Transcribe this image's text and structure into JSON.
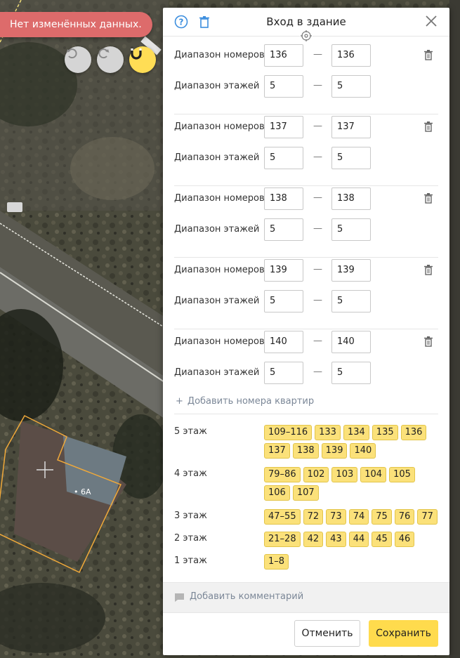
{
  "map": {
    "status_text": "Нет изменённых данных.",
    "house_label": "• 6А"
  },
  "panel": {
    "title": "Вход в здание",
    "entries": [
      {
        "numbers_label": "Диапазон номеров",
        "num_from": "136",
        "num_to": "136",
        "floors_label": "Диапазон этажей",
        "floor_from": "5",
        "floor_to": "5"
      },
      {
        "numbers_label": "Диапазон номеров",
        "num_from": "137",
        "num_to": "137",
        "floors_label": "Диапазон этажей",
        "floor_from": "5",
        "floor_to": "5"
      },
      {
        "numbers_label": "Диапазон номеров",
        "num_from": "138",
        "num_to": "138",
        "floors_label": "Диапазон этажей",
        "floor_from": "5",
        "floor_to": "5"
      },
      {
        "numbers_label": "Диапазон номеров",
        "num_from": "139",
        "num_to": "139",
        "floors_label": "Диапазон этажей",
        "floor_from": "5",
        "floor_to": "5"
      },
      {
        "numbers_label": "Диапазон номеров",
        "num_from": "140",
        "num_to": "140",
        "floors_label": "Диапазон этажей",
        "floor_from": "5",
        "floor_to": "5"
      }
    ],
    "dash": "—",
    "add_link": "Добавить номера квартир",
    "add_plus": "+",
    "floors": [
      {
        "label": "5 этаж",
        "chips": [
          "109–116",
          "133",
          "134",
          "135",
          "136",
          "137",
          "138",
          "139",
          "140"
        ]
      },
      {
        "label": "4 этаж",
        "chips": [
          "79–86",
          "102",
          "103",
          "104",
          "105",
          "106",
          "107"
        ]
      },
      {
        "label": "3 этаж",
        "chips": [
          "47–55",
          "72",
          "73",
          "74",
          "75",
          "76",
          "77"
        ]
      },
      {
        "label": "2 этаж",
        "chips": [
          "21–28",
          "42",
          "43",
          "44",
          "45",
          "46"
        ]
      },
      {
        "label": "1 этаж",
        "chips": [
          "1–8"
        ]
      }
    ],
    "comment_link": "Добавить комментарий",
    "cancel_label": "Отменить",
    "save_label": "Сохранить"
  },
  "icons": {
    "help": "help-circle-icon",
    "trash": "trash-icon",
    "close": "close-icon",
    "target": "crosshair-icon",
    "undo": "undo-icon",
    "redo": "redo-icon",
    "magnet": "magnet-icon",
    "comment": "comment-icon"
  },
  "colors": {
    "status_pill": "#dd6b6b",
    "accent_yellow": "#ffdb4d",
    "chip_fill": "#fbe17a",
    "link_grey": "#7b8797",
    "help_blue": "#3c8ede",
    "building_outline": "#f0a93a"
  }
}
